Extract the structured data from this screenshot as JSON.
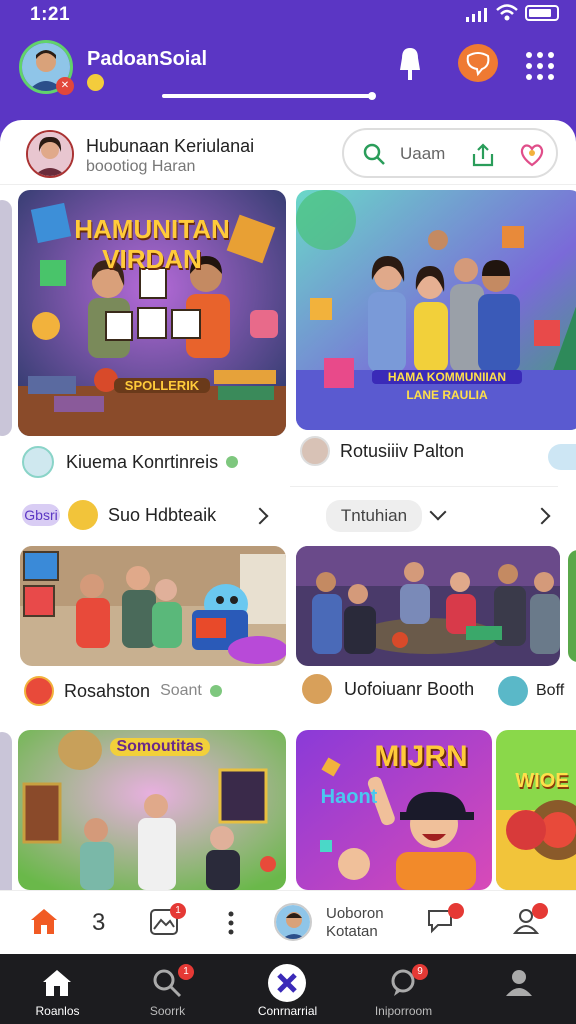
{
  "status": {
    "time": "1:21"
  },
  "header": {
    "title": "PadoanSoial"
  },
  "subheader": {
    "line1": "Hubunaan Keriulanai",
    "line2": "boootiog Haran",
    "search_text": "Uaam"
  },
  "cards": {
    "top_left": {
      "title_1": "HAMUNITAN",
      "title_2": "VIRDAN",
      "banner": "SPOLLERIK"
    },
    "top_right": {
      "banner_1": "HAMA KOMMUNIIAN",
      "banner_2": "LANE RAULIA"
    },
    "bottom_left": {
      "banner": "Somoutitas"
    },
    "bottom_mid": {
      "title_1": "MIJRN",
      "title_2": "Haont"
    },
    "bottom_right": {
      "title": "WIOE"
    }
  },
  "rows": {
    "r1_left": "Kiuema Konrtinreis",
    "r1_right": "Rotusiiiv Palton",
    "r2_chip": "Gbsri",
    "r2_left": "Suo Hdbteaik",
    "r2_pill": "Tntuhian",
    "r3_left": "Rosahston",
    "r3_left_sub": "Soant",
    "r3_mid": "Uofoiuanr Booth",
    "r3_right": "Boff"
  },
  "bar1": {
    "number": "3",
    "name_1": "Uoboron",
    "name_2": "Kotatan",
    "badge": "1"
  },
  "tabs": [
    {
      "label": "Roanlos"
    },
    {
      "label": "Soorrk"
    },
    {
      "label": "Conrnarrial"
    },
    {
      "label": "Iniporroom"
    },
    {
      "label": ""
    }
  ],
  "colors": {
    "header_purple": "#5b36c4",
    "accent_orange": "#f15a24",
    "badge_red": "#e53935"
  }
}
